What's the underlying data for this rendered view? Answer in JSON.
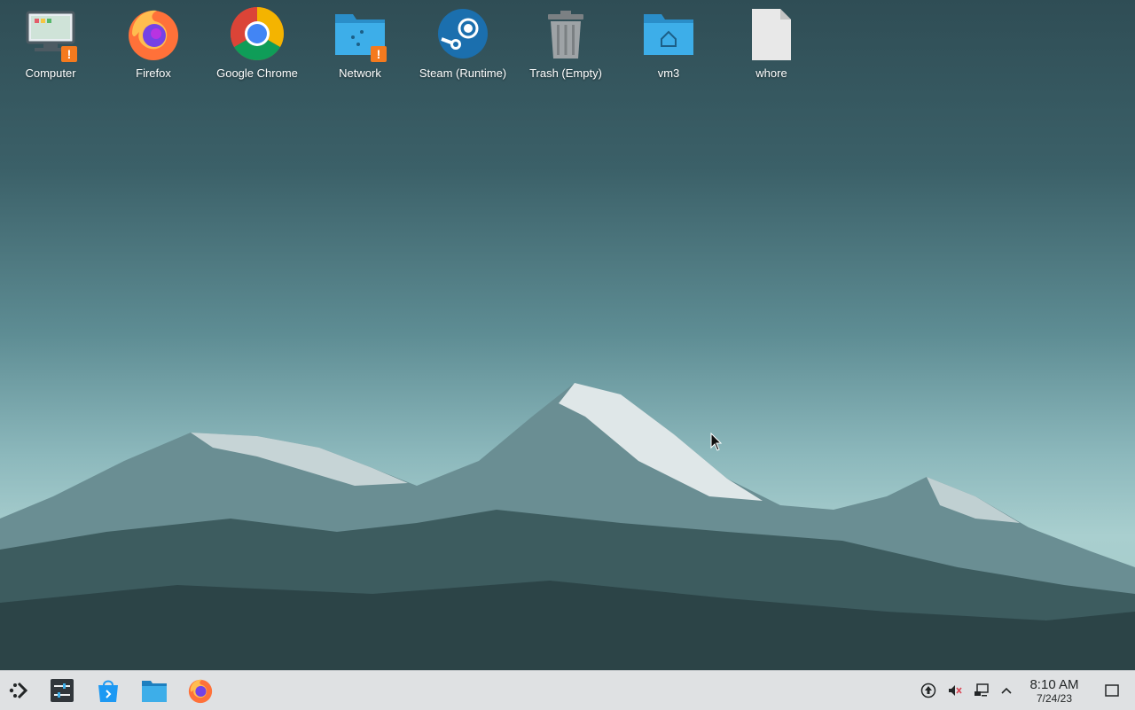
{
  "desktop": {
    "icons": [
      {
        "label": "Computer",
        "icon": "computer-icon",
        "badge": "!"
      },
      {
        "label": "Firefox",
        "icon": "firefox-icon"
      },
      {
        "label": "Google Chrome",
        "icon": "chrome-icon"
      },
      {
        "label": "Network",
        "icon": "network-folder-icon",
        "badge": "!"
      },
      {
        "label": "Steam (Runtime)",
        "icon": "steam-icon"
      },
      {
        "label": "Trash (Empty)",
        "icon": "trash-icon"
      },
      {
        "label": "vm3",
        "icon": "home-folder-icon"
      },
      {
        "label": "whore",
        "icon": "file-icon"
      }
    ]
  },
  "taskbar": {
    "launchers": [
      "application-launcher-icon",
      "system-settings-icon",
      "discover-store-icon",
      "file-manager-icon",
      "firefox-icon"
    ],
    "tray": [
      "update-icon",
      "volume-muted-icon",
      "network-icon",
      "expand-tray-icon"
    ],
    "clock": {
      "time": "8:10 AM",
      "date": "7/24/23"
    },
    "show_desktop": "show-desktop-icon"
  },
  "colors": {
    "taskbar_bg": "#dfe1e3",
    "folder_blue": "#3daee9",
    "warning_orange": "#f47a1e"
  }
}
